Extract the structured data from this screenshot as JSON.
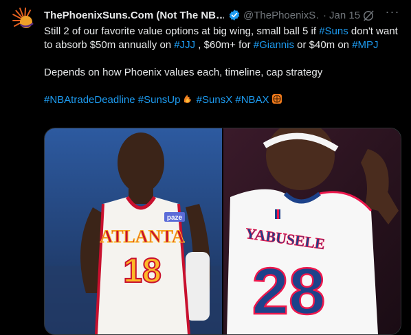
{
  "tweet": {
    "display_name": "ThePhoenixSuns.Com (Not The NB…",
    "handle": "@ThePhoenixS…",
    "separator": "·",
    "date": "Jan 15",
    "more_label": "···",
    "text": {
      "p1_part1": "Still 2 of our favorite value options at big wing, small ball 5 if ",
      "p1_tag_suns": "#Suns",
      "p1_part2": " don't want to absorb $50m annually on ",
      "p1_tag_jjj": "#JJJ",
      "p1_part3": " , $60m+ for ",
      "p1_tag_giannis": "#Giannis",
      "p1_part4": " or $40m on ",
      "p1_tag_mpj": "#MPJ",
      "p2": "Depends on how Phoenix values each, timeline, cap strategy",
      "tag_deadline": "#NBAtradeDeadline",
      "tag_sunsup": "#SunsUp",
      "tag_sunsx": "#SunsX",
      "tag_nbax": "#NBAX"
    }
  },
  "media": {
    "left_photo": {
      "jersey_team": "ATLANTA",
      "jersey_number": "18",
      "patch": "paze"
    },
    "right_photo": {
      "jersey_name": "YABUSELE",
      "jersey_number": "28"
    }
  },
  "colors": {
    "background": "#000000",
    "text": "#e7e9ea",
    "muted": "#71767b",
    "link": "#1d9bf0",
    "verified": "#1d9bf0",
    "hawks_red": "#c8102e",
    "hawks_gold": "#fdb927",
    "sixers_blue": "#1d428a",
    "sixers_red": "#ed174c"
  },
  "icons": [
    "suns-logo-avatar",
    "verified-badge-icon",
    "grok-icon",
    "more-options-icon",
    "suns-flame-emoji",
    "basketball-emoji"
  ]
}
